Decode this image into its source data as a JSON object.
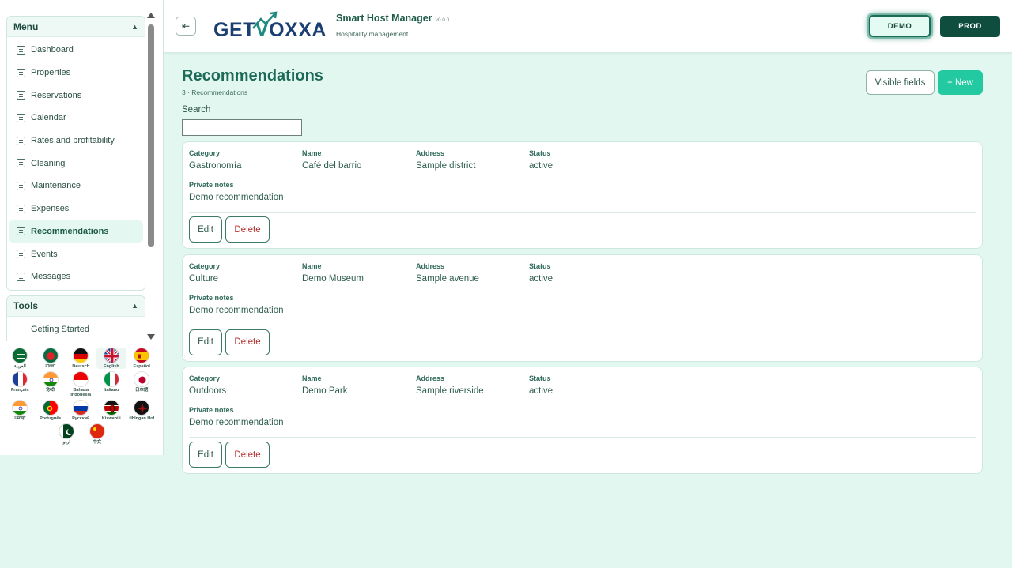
{
  "sidebar": {
    "menu_title": "Menu",
    "menu_items": [
      {
        "label": "Dashboard",
        "active": false
      },
      {
        "label": "Properties",
        "active": false
      },
      {
        "label": "Reservations",
        "active": false
      },
      {
        "label": "Calendar",
        "active": false
      },
      {
        "label": "Rates and profitability",
        "active": false
      },
      {
        "label": "Cleaning",
        "active": false
      },
      {
        "label": "Maintenance",
        "active": false
      },
      {
        "label": "Expenses",
        "active": false
      },
      {
        "label": "Recommendations",
        "active": true
      },
      {
        "label": "Events",
        "active": false
      },
      {
        "label": "Messages",
        "active": false
      }
    ],
    "tools_title": "Tools",
    "tools_items": [
      {
        "label": "Getting Started"
      }
    ],
    "languages": [
      {
        "label": "العربية",
        "flag": "sa"
      },
      {
        "label": "বাংলা",
        "flag": "bd"
      },
      {
        "label": "Deutsch",
        "flag": "de"
      },
      {
        "label": "English",
        "flag": "gb",
        "selected": true
      },
      {
        "label": "Español",
        "flag": "es"
      },
      {
        "label": "Français",
        "flag": "fr"
      },
      {
        "label": "हिन्दी",
        "flag": "in"
      },
      {
        "label": "Bahasa Indonesia",
        "flag": "id"
      },
      {
        "label": "Italiano",
        "flag": "it"
      },
      {
        "label": "日本語",
        "flag": "jp"
      },
      {
        "label": "ਪੰਜਾਬੀ",
        "flag": "in"
      },
      {
        "label": "Português",
        "flag": "pt"
      },
      {
        "label": "Русский",
        "flag": "ru"
      },
      {
        "label": "Kiswahili",
        "flag": "ke"
      },
      {
        "label": "tlhIngan Hol",
        "flag": "kl"
      },
      {
        "label": "اردو",
        "flag": "pk"
      },
      {
        "label": "中文",
        "flag": "cn"
      }
    ]
  },
  "header": {
    "logo_left": "GET",
    "logo_v": "V",
    "logo_right": "OXXA",
    "app_title": "Smart Host Manager",
    "version": "v0.0.0",
    "subtitle": "Hospitality management",
    "demo_label": "DEMO",
    "prod_label": "PROD"
  },
  "main": {
    "title": "Recommendations",
    "count": "3 · Recommendations",
    "search_label": "Search",
    "search_value": "",
    "visible_fields_label": "Visible fields",
    "new_label": "+ New",
    "labels": {
      "category": "Category",
      "name": "Name",
      "address": "Address",
      "status": "Status",
      "notes": "Private notes",
      "edit": "Edit",
      "delete": "Delete"
    },
    "cards": [
      {
        "category": "Gastronomía",
        "name": "Café del barrio",
        "address": "Sample district",
        "status": "active",
        "notes": "Demo recommendation"
      },
      {
        "category": "Culture",
        "name": "Demo Museum",
        "address": "Sample avenue",
        "status": "active",
        "notes": "Demo recommendation"
      },
      {
        "category": "Outdoors",
        "name": "Demo Park",
        "address": "Sample riverside",
        "status": "active",
        "notes": "Demo recommendation"
      }
    ]
  }
}
